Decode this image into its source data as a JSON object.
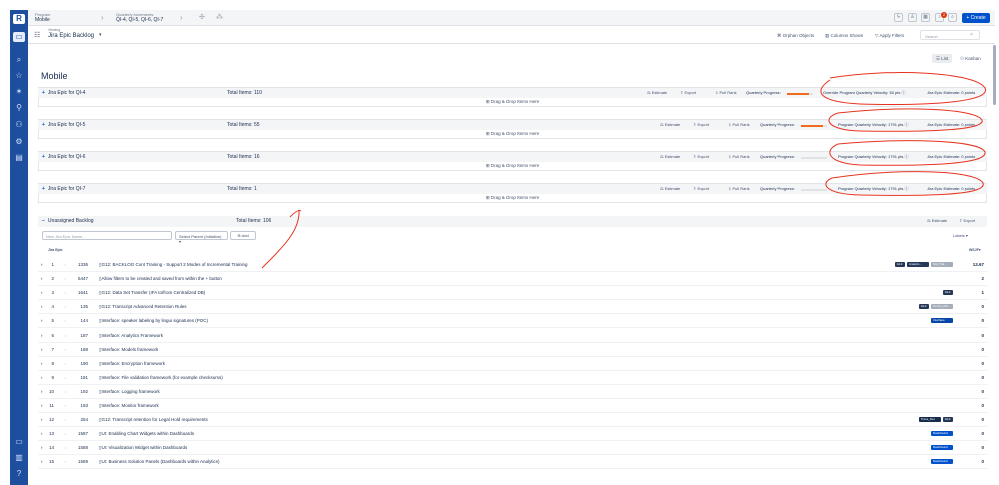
{
  "topbar": {
    "program_label": "Program",
    "program_value": "Mobile",
    "qi_label": "Quarterly Increments",
    "qi_value": "QI-4, QI-5, QI-6, QI-7",
    "notification_count": "2",
    "create_label": "Create"
  },
  "viewbar": {
    "viewing_label": "Viewing",
    "viewing_value": "Jira Epic Backlog",
    "orphan_label": "Orphan Objects",
    "columns_label": "Columns Shown",
    "filters_label": "Apply Filters",
    "search_placeholder": "Search"
  },
  "tabs": {
    "list": "List",
    "kanban": "Kanban"
  },
  "page_title": "Mobile",
  "common": {
    "estimate": "Estimate",
    "export": "Export",
    "pull_rank": "Pull Rank",
    "quarterly_progress": "Quarterly Progress:",
    "dropzone": "Drag & Drop Items Here"
  },
  "sections": [
    {
      "name": "Jira Epic for QI-4",
      "total": "Total Items: 110",
      "velocity": "Override Program Quarterly Velocity: 50 pts",
      "estimate": "Jira Epic Estimate: 0 points",
      "progress": 0.85
    },
    {
      "name": "Jira Epic for QI-5",
      "total": "Total Items: 55",
      "velocity": "Program Quarterly Velocity: 1791 pts",
      "estimate": "Jira Epic Estimate: 0 points",
      "progress": 0.85
    },
    {
      "name": "Jira Epic for QI-6",
      "total": "Total Items: 16",
      "velocity": "Program Quarterly Velocity: 1791 pts",
      "estimate": "Jira Epic Estimate: 0 points",
      "progress": 0
    },
    {
      "name": "Jira Epic for QI-7",
      "total": "Total Items: 1",
      "velocity": "Program Quarterly Velocity: 1791 pts",
      "estimate": "Jira Epic Estimate: 0 points",
      "progress": 0
    }
  ],
  "unassigned": {
    "name": "Unassigned Backlog",
    "total": "Total Items: 106",
    "new_placeholder": "New Jira Epic Name...",
    "select_parent": "Select Parent (Initiative)",
    "add_label": "Add",
    "labels_label": "Labels",
    "col_epic": "Jira Epic",
    "col_wsjf": "WSJF"
  },
  "rows": [
    {
      "n": "1",
      "id": "1336",
      "title": "G12: BACKLOG Cont Training - Support 2 Modes of Incremental Training",
      "wsjf": "13.67",
      "labels": [
        "G12",
        "Analytic...",
        "Std_Trai..."
      ]
    },
    {
      "n": "2",
      "id": "5447",
      "title": "Allow filters to be created and saved from within the + button",
      "wsjf": "2",
      "labels": []
    },
    {
      "n": "3",
      "id": "1641",
      "title": "G12: Data Set Transfer (IFA to/from Centralized DB)",
      "wsjf": "1",
      "labels": [
        "G12"
      ]
    },
    {
      "n": "4",
      "id": "135",
      "title": "G12: Transcript Advanced Retention Rules",
      "wsjf": "0",
      "labels": [
        "G12",
        "Comm_Ret..."
      ]
    },
    {
      "n": "5",
      "id": "144",
      "title": "Interface: speaker labeling by lingui signatures (POC)",
      "wsjf": "0",
      "labels": [
        "Interface"
      ]
    },
    {
      "n": "6",
      "id": "187",
      "title": "Interface: Analytics Framework",
      "wsjf": "0",
      "labels": []
    },
    {
      "n": "7",
      "id": "188",
      "title": "Interface: Models framework",
      "wsjf": "0",
      "labels": []
    },
    {
      "n": "8",
      "id": "190",
      "title": "Interface: Encryption framework",
      "wsjf": "0",
      "labels": []
    },
    {
      "n": "9",
      "id": "191",
      "title": "Interface: File validation framework (for example checksums)",
      "wsjf": "0",
      "labels": []
    },
    {
      "n": "10",
      "id": "192",
      "title": "Interface: Logging framework",
      "wsjf": "0",
      "labels": []
    },
    {
      "n": "11",
      "id": "193",
      "title": "Interface: Monitor framework",
      "wsjf": "0",
      "labels": []
    },
    {
      "n": "12",
      "id": "254",
      "title": "G12: Transcript retention for Legal Hold requirements",
      "wsjf": "0",
      "labels": [
        "Trans_Ret",
        "G12"
      ]
    },
    {
      "n": "13",
      "id": "1587",
      "title": "UI: Enabling Chart Widgets within Dashboards",
      "wsjf": "0",
      "labels": [
        "Dashboard"
      ]
    },
    {
      "n": "14",
      "id": "1588",
      "title": "UI: Visualization Widget within Dashboards",
      "wsjf": "0",
      "labels": [
        "Dashboard"
      ]
    },
    {
      "n": "15",
      "id": "1589",
      "title": "UI: Business Solution Panels (Dashboards within Analytics)",
      "wsjf": "0",
      "labels": [
        "Dashboard"
      ]
    }
  ],
  "colors": {
    "brand": "#1d4f9e",
    "accent": "#0052cc",
    "annotation": "#e8321f",
    "progress": "#f26a1b"
  }
}
